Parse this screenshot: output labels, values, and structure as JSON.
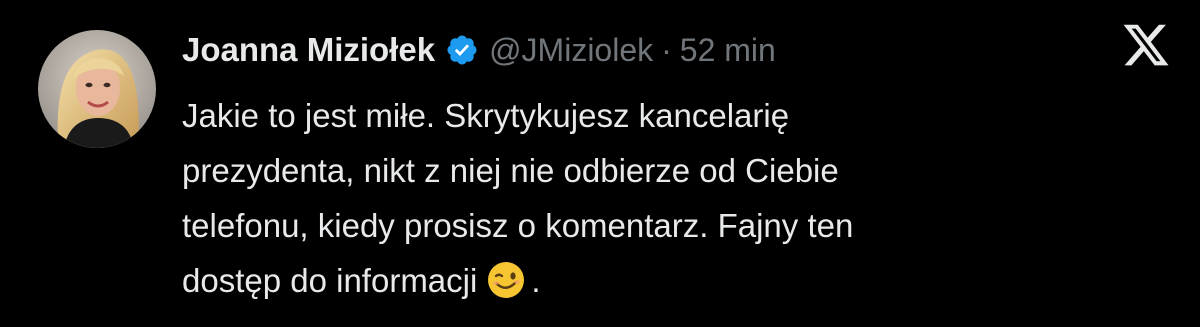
{
  "tweet": {
    "author": {
      "display_name": "Joanna Miziołek",
      "handle": "@JMiziolek",
      "verified": true,
      "avatar_icon": "profile-photo"
    },
    "separator": "·",
    "timestamp": "52 min",
    "text_lines": [
      "Jakie to jest miłe. Skrytykujesz kancelarię",
      "prezydenta, nikt z niej nie odbierze od Ciebie",
      "telefonu, kiedy prosisz o komentarz. Fajny ten",
      "dostęp do informacji"
    ],
    "trailing_punctuation": ".",
    "emoji": "winking-face"
  },
  "platform": {
    "logo_icon": "x-logo"
  },
  "colors": {
    "background": "#000000",
    "text_primary": "#e7e9ea",
    "text_secondary": "#71767b",
    "verified_badge": "#1d9bf0"
  }
}
